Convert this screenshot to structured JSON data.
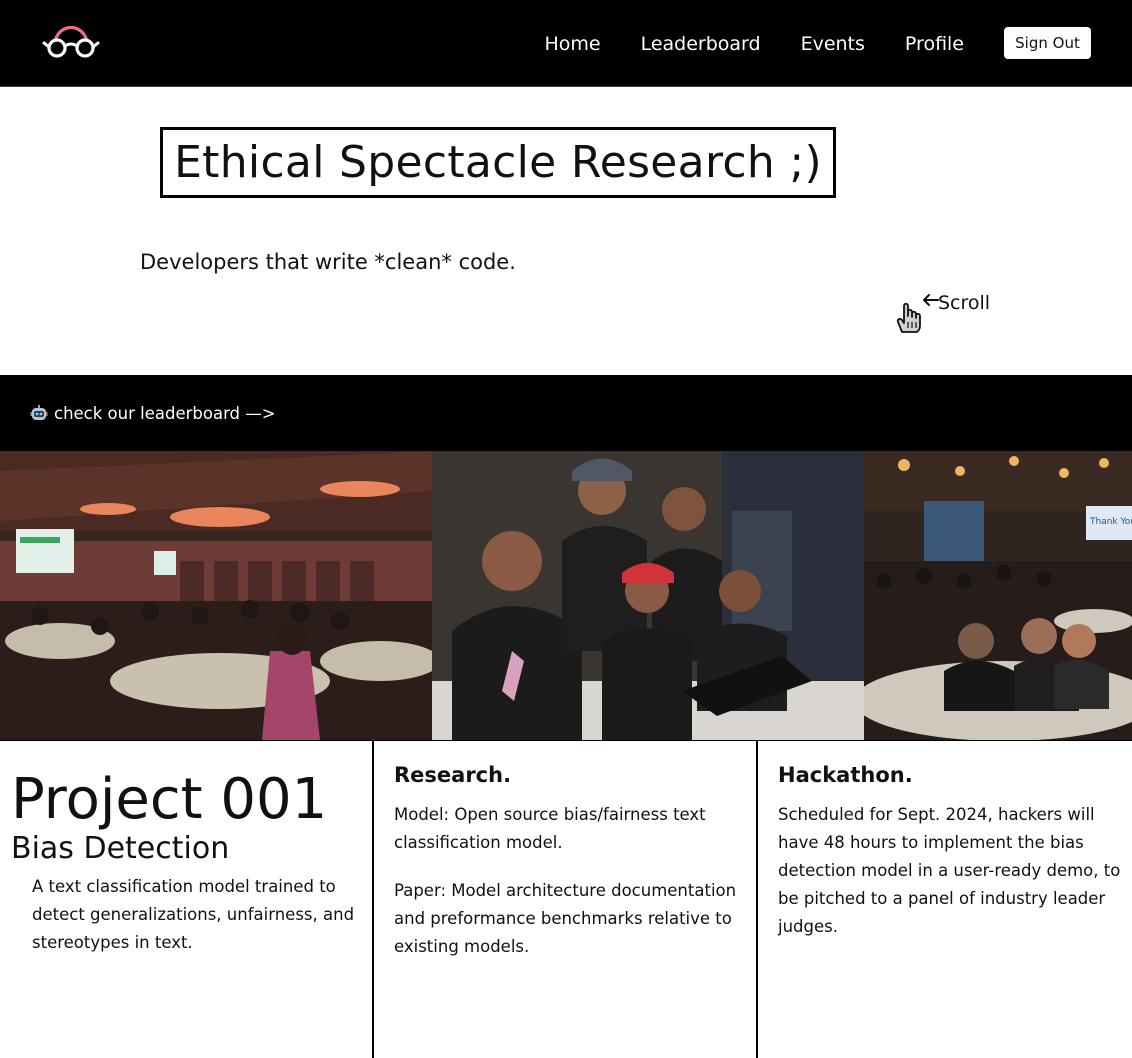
{
  "nav": {
    "links": [
      "Home",
      "Leaderboard",
      "Events",
      "Profile"
    ],
    "sign_out": "Sign Out"
  },
  "hero": {
    "title": "Ethical Spectacle Research ;)",
    "tagline": "Developers that write *clean* code.",
    "scroll_label": "Scroll"
  },
  "banner": {
    "text": "check our leaderboard —>"
  },
  "project": {
    "title": "Project 001",
    "subtitle": "Bias Detection",
    "description": "A text classification model trained to detect generalizations, unfairness, and stereotypes in text."
  },
  "research": {
    "heading": "Research.",
    "model": "Model: Open source bias/fairness text classification model.",
    "paper": "Paper: Model architecture documentation and preformance benchmarks relative to existing models."
  },
  "hackathon": {
    "heading": "Hackathon.",
    "text": "Scheduled for Sept. 2024, hackers will have 48 hours to implement the bias detection model in a user-ready demo, to be pitched to a panel of industry leader judges."
  },
  "photos": {
    "screen_text": "Thank You"
  },
  "colors": {
    "nav_bg": "#000000",
    "accent_pink": "#e8707e",
    "text": "#111111"
  }
}
